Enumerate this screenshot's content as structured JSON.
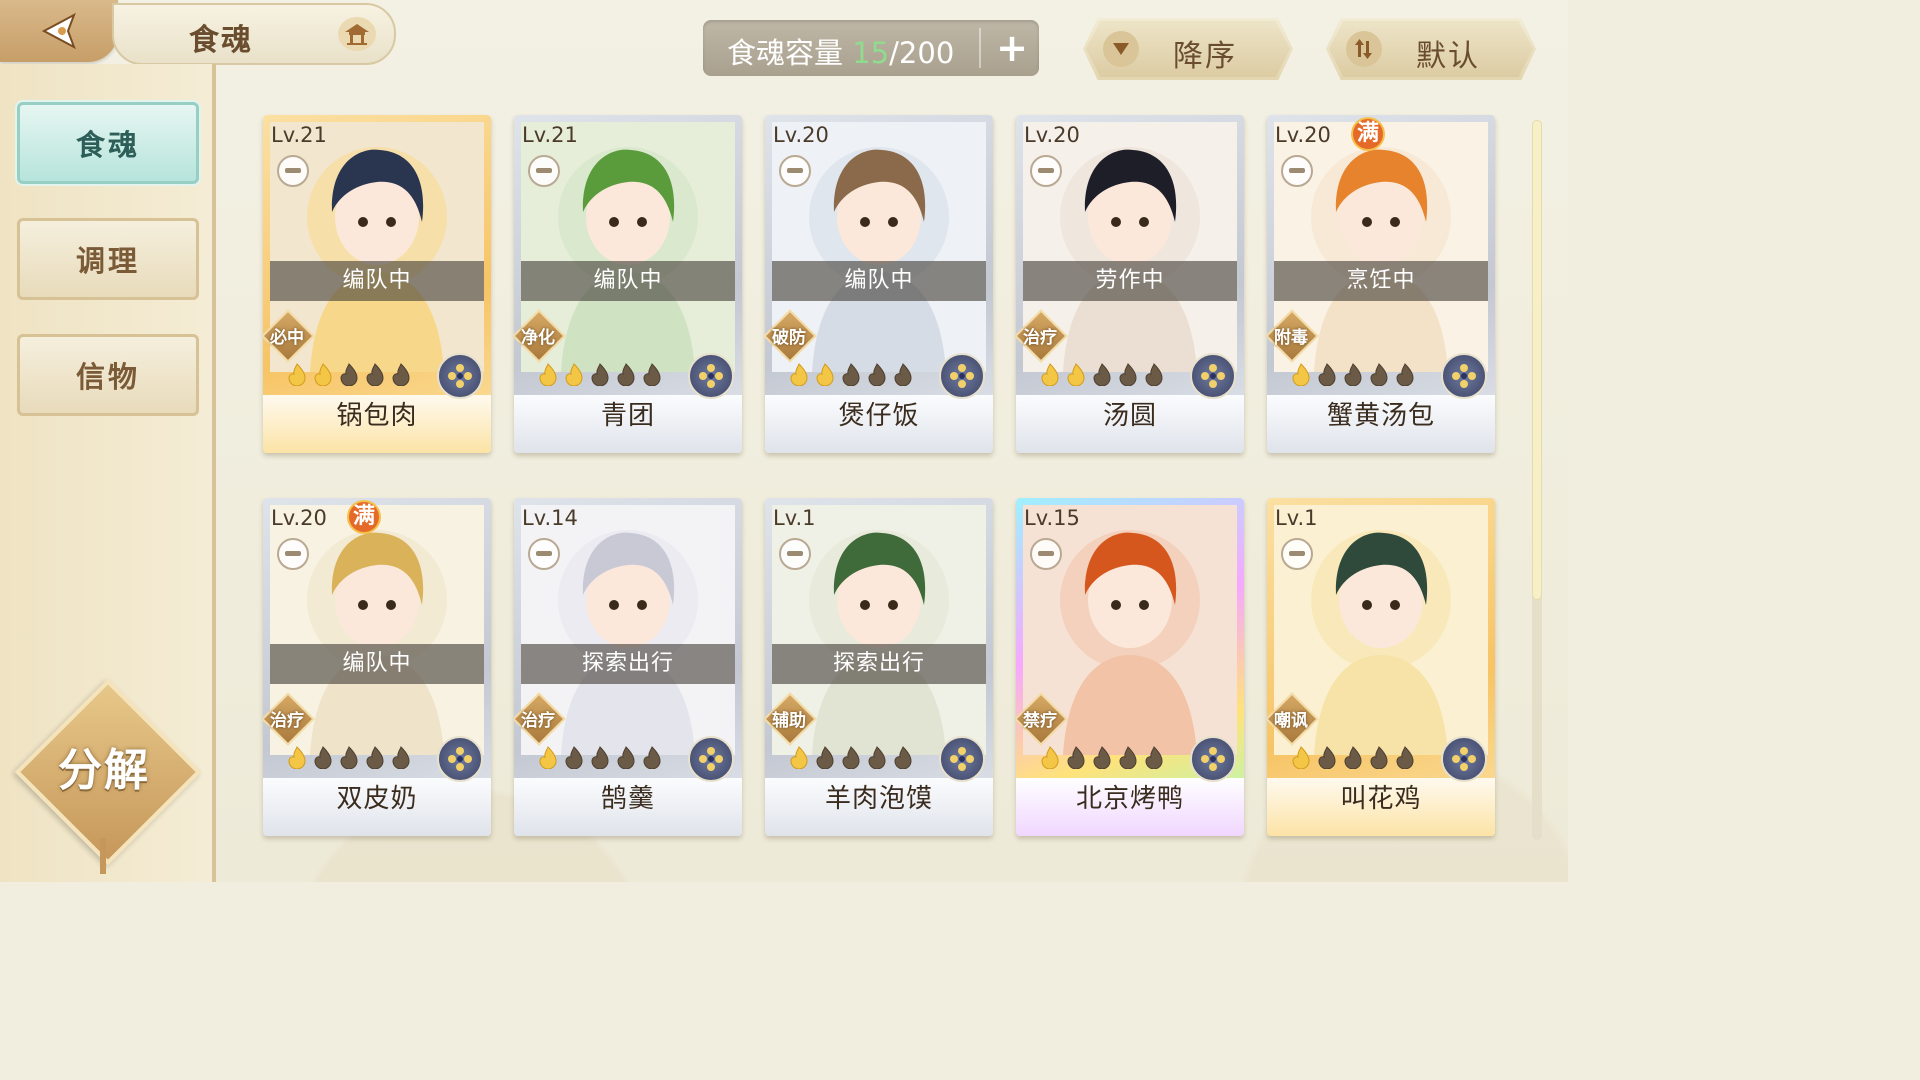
{
  "header": {
    "title": "食魂",
    "capacity_label": "食魂容量",
    "capacity_current": "15",
    "capacity_total": "/200",
    "sort_order_label": "降序",
    "sort_mode_label": "默认"
  },
  "sidebar": {
    "tabs": [
      {
        "label": "食魂",
        "active": true
      },
      {
        "label": "调理",
        "active": false
      },
      {
        "label": "信物",
        "active": false
      }
    ],
    "decompose_label": "分解"
  },
  "cards": [
    {
      "level": "Lv.21",
      "name": "锅包肉",
      "status": "编队中",
      "role": "必中",
      "stars_filled": 2,
      "stars_total": 5,
      "full": false,
      "tier": "gold"
    },
    {
      "level": "Lv.21",
      "name": "青团",
      "status": "编队中",
      "role": "净化",
      "stars_filled": 2,
      "stars_total": 5,
      "full": false,
      "tier": "silver"
    },
    {
      "level": "Lv.20",
      "name": "煲仔饭",
      "status": "编队中",
      "role": "破防",
      "stars_filled": 2,
      "stars_total": 5,
      "full": false,
      "tier": "silver"
    },
    {
      "level": "Lv.20",
      "name": "汤圆",
      "status": "劳作中",
      "role": "治疗",
      "stars_filled": 2,
      "stars_total": 5,
      "full": false,
      "tier": "silver"
    },
    {
      "level": "Lv.20",
      "name": "蟹黄汤包",
      "status": "烹饪中",
      "role": "附毒",
      "stars_filled": 1,
      "stars_total": 5,
      "full": true,
      "full_label": "满",
      "tier": "silver"
    },
    {
      "level": "Lv.20",
      "name": "双皮奶",
      "status": "编队中",
      "role": "治疗",
      "stars_filled": 1,
      "stars_total": 5,
      "full": true,
      "full_label": "满",
      "tier": "silver"
    },
    {
      "level": "Lv.14",
      "name": "鹄羹",
      "status": "探索出行",
      "role": "治疗",
      "stars_filled": 1,
      "stars_total": 5,
      "full": false,
      "tier": "silver"
    },
    {
      "level": "Lv.1",
      "name": "羊肉泡馍",
      "status": "探索出行",
      "role": "辅助",
      "stars_filled": 1,
      "stars_total": 5,
      "full": false,
      "tier": "silver"
    },
    {
      "level": "Lv.15",
      "name": "北京烤鸭",
      "status": "",
      "role": "禁疗",
      "stars_filled": 1,
      "stars_total": 5,
      "full": false,
      "tier": "rainbow"
    },
    {
      "level": "Lv.1",
      "name": "叫花鸡",
      "status": "",
      "role": "嘲讽",
      "stars_filled": 1,
      "stars_total": 5,
      "full": false,
      "tier": "gold"
    }
  ],
  "colors": {
    "accent_teal": "#b6e4dc",
    "gold": "#f7c465",
    "capacity_current": "#8fdc8e"
  }
}
